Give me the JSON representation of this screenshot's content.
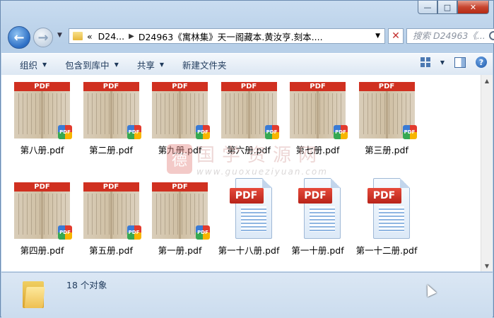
{
  "window": {
    "buttons": {
      "minimize": "—",
      "maximize": "□",
      "close": "✕"
    }
  },
  "nav": {
    "back_icon": "←",
    "forward_icon": "→",
    "breadcrumb": [
      "D24...",
      "D24963《寓林集》天一阁藏本.黄汝亨.刻本...."
    ],
    "breadcrumb_prefix": "«",
    "search_placeholder": "搜索 D24963《..."
  },
  "toolbar": {
    "organize": "组织",
    "include_library": "包含到库中",
    "share": "共享",
    "new_folder": "新建文件夹"
  },
  "files": [
    {
      "name": "第八册.pdf",
      "kind": "scan"
    },
    {
      "name": "第二册.pdf",
      "kind": "scan"
    },
    {
      "name": "第九册.pdf",
      "kind": "scan"
    },
    {
      "name": "第六册.pdf",
      "kind": "scan"
    },
    {
      "name": "第七册.pdf",
      "kind": "scan"
    },
    {
      "name": "第三册.pdf",
      "kind": "scan"
    },
    {
      "name": "第四册.pdf",
      "kind": "scan"
    },
    {
      "name": "第五册.pdf",
      "kind": "scan"
    },
    {
      "name": "第一册.pdf",
      "kind": "scan"
    },
    {
      "name": "第一十八册.pdf",
      "kind": "doc"
    },
    {
      "name": "第一十册.pdf",
      "kind": "doc"
    },
    {
      "name": "第一十二册.pdf",
      "kind": "doc"
    }
  ],
  "thumb_band": "PDF",
  "badge_text": "PDF",
  "watermark": {
    "cn": "国学资源网",
    "url": "www.guoxueziyuan.com",
    "seal": "德"
  },
  "status": {
    "count": "18 个对象"
  }
}
